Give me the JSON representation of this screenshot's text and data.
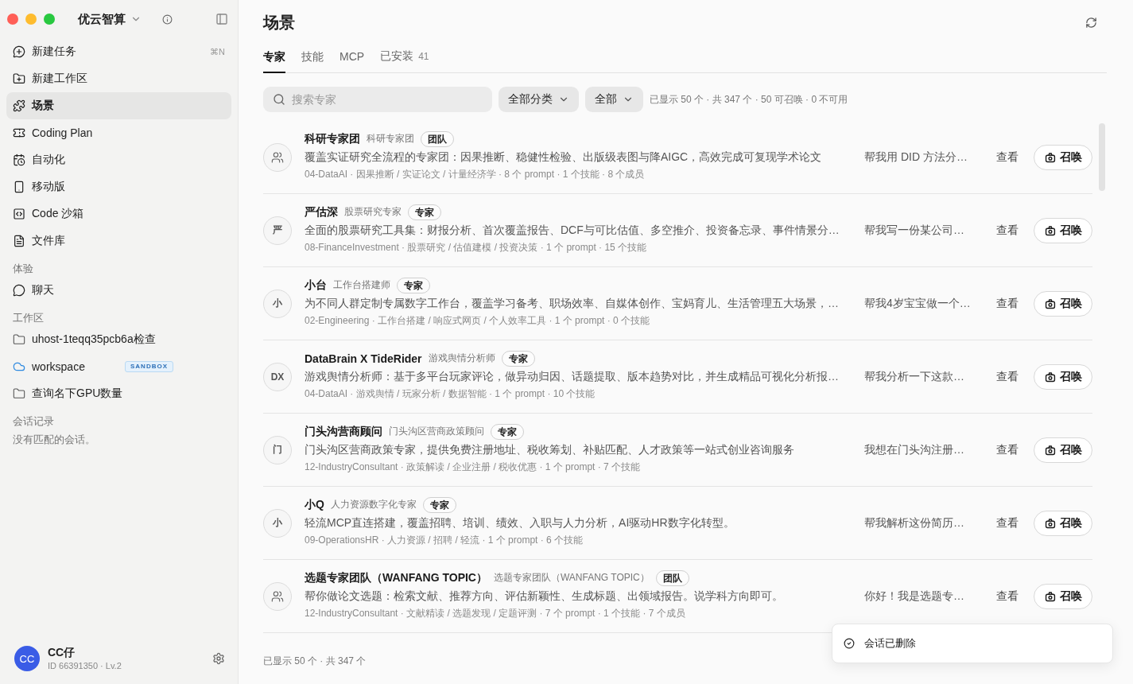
{
  "window": {
    "app_name": "优云智算"
  },
  "sidebar": {
    "nav": [
      {
        "label": "新建任务",
        "shortcut": "⌘N",
        "selected": false
      },
      {
        "label": "新建工作区",
        "selected": false
      },
      {
        "label": "场景",
        "selected": true
      },
      {
        "label": "Coding Plan",
        "selected": false
      },
      {
        "label": "自动化",
        "selected": false
      },
      {
        "label": "移动版",
        "selected": false
      },
      {
        "label": "Code 沙箱",
        "selected": false
      },
      {
        "label": "文件库",
        "selected": false
      }
    ],
    "sections": [
      {
        "title": "体验",
        "items": [
          {
            "kind": "chat",
            "label": "聊天",
            "selected": false
          }
        ]
      },
      {
        "title": "工作区",
        "items": [
          {
            "kind": "folder",
            "label": "uhost-1teqq35pcb6a检查",
            "selected": false
          },
          {
            "kind": "sandbox",
            "label": "workspace",
            "badge": "SANDBOX",
            "selected": false
          },
          {
            "kind": "folder",
            "label": "查询名下GPU数量",
            "selected": false
          }
        ]
      },
      {
        "title": "会话记录",
        "empty_text": "没有匹配的会话。"
      }
    ],
    "user": {
      "avatar": "CC",
      "name": "CC仔",
      "meta": "ID 66391350 · Lv.2"
    }
  },
  "main": {
    "title": "场景",
    "tabs": [
      {
        "label": "专家",
        "selected": true
      },
      {
        "label": "技能",
        "selected": false
      },
      {
        "label": "MCP",
        "selected": false
      },
      {
        "label": "已安装",
        "count": "41",
        "selected": false
      }
    ],
    "filters": {
      "search_placeholder": "搜索专家",
      "dropdowns": [
        "全部分类",
        "全部"
      ],
      "stats": "已显示 50 个 · 共 347 个 · 50 可召唤 · 0 不可用"
    },
    "experts": [
      {
        "kind": "team",
        "name": "科研专家团",
        "role": "科研专家团",
        "tag": "团队",
        "description": "覆盖实证研究全流程的专家团：因果推断、稳健性检验、出版级表图与降AIGC，高效完成可复现学术论文",
        "meta": "04-DataAI · 因果推断 / 实证论文 / 计量经济学 · 8 个 prompt · 1 个技能 · 8 个成员",
        "prompt": "帮我用 DID 方法分…",
        "view": "查看",
        "action": "召唤"
      },
      {
        "kind": "single",
        "avatar": "严",
        "name": "严估深",
        "role": "股票研究专家",
        "tag": "专家",
        "description": "全面的股票研究工具集：财报分析、首次覆盖报告、DCF与可比估值、多空推介、投资备忘录、事件情景分…",
        "meta": "08-FinanceInvestment · 股票研究 / 估值建模 / 投资决策 · 1 个 prompt · 15 个技能",
        "prompt": "帮我写一份某公司…",
        "view": "查看",
        "action": "召唤"
      },
      {
        "kind": "single",
        "avatar": "小",
        "name": "小台",
        "role": "工作台搭建师",
        "tag": "专家",
        "description": "为不同人群定制专属数字工作台，覆盖学习备考、职场效率、自媒体创作、宝妈育儿、生活管理五大场景，…",
        "meta": "02-Engineering · 工作台搭建 / 响应式网页 / 个人效率工具 · 1 个 prompt · 0 个技能",
        "prompt": "帮我4岁宝宝做一个…",
        "view": "查看",
        "action": "召唤"
      },
      {
        "kind": "single",
        "avatar": "DX",
        "name": "DataBrain X TideRider",
        "role": "游戏舆情分析师",
        "tag": "专家",
        "description": "游戏舆情分析师：基于多平台玩家评论，做异动归因、话题提取、版本趋势对比，并生成精品可视化分析报…",
        "meta": "04-DataAI · 游戏舆情 / 玩家分析 / 数据智能 · 1 个 prompt · 10 个技能",
        "prompt": "帮我分析一下这款…",
        "view": "查看",
        "action": "召唤"
      },
      {
        "kind": "single",
        "avatar": "门",
        "name": "门头沟营商顾问",
        "role": "门头沟区营商政策顾问",
        "tag": "专家",
        "description": "门头沟区营商政策专家，提供免费注册地址、税收筹划、补贴匹配、人才政策等一站式创业咨询服务",
        "meta": "12-IndustryConsultant · 政策解读 / 企业注册 / 税收优惠 · 1 个 prompt · 7 个技能",
        "prompt": "我想在门头沟注册…",
        "view": "查看",
        "action": "召唤"
      },
      {
        "kind": "single",
        "avatar": "小",
        "name": "小Q",
        "role": "人力资源数字化专家",
        "tag": "专家",
        "description": "轻流MCP直连搭建，覆盖招聘、培训、绩效、入职与人力分析，AI驱动HR数字化转型。",
        "meta": "09-OperationsHR · 人力资源 / 招聘 / 轻流 · 1 个 prompt · 6 个技能",
        "prompt": "帮我解析这份简历…",
        "view": "查看",
        "action": "召唤"
      },
      {
        "kind": "team",
        "name": "选题专家团队（WANFANG TOPIC）",
        "role": "选题专家团队（WANFANG TOPIC）",
        "tag": "团队",
        "description": "帮你做论文选题：检索文献、推荐方向、评估新颖性、生成标题、出领域报告。说学科方向即可。",
        "meta": "12-IndustryConsultant · 文献精读 / 选题发现 / 定题评测 · 7 个 prompt · 1 个技能 · 7 个成员",
        "prompt": "你好！我是选题专…",
        "view": "查看",
        "action": "召唤"
      }
    ],
    "footer": "已显示 50 个 · 共 347 个"
  },
  "toast": {
    "message": "会话已删除"
  }
}
